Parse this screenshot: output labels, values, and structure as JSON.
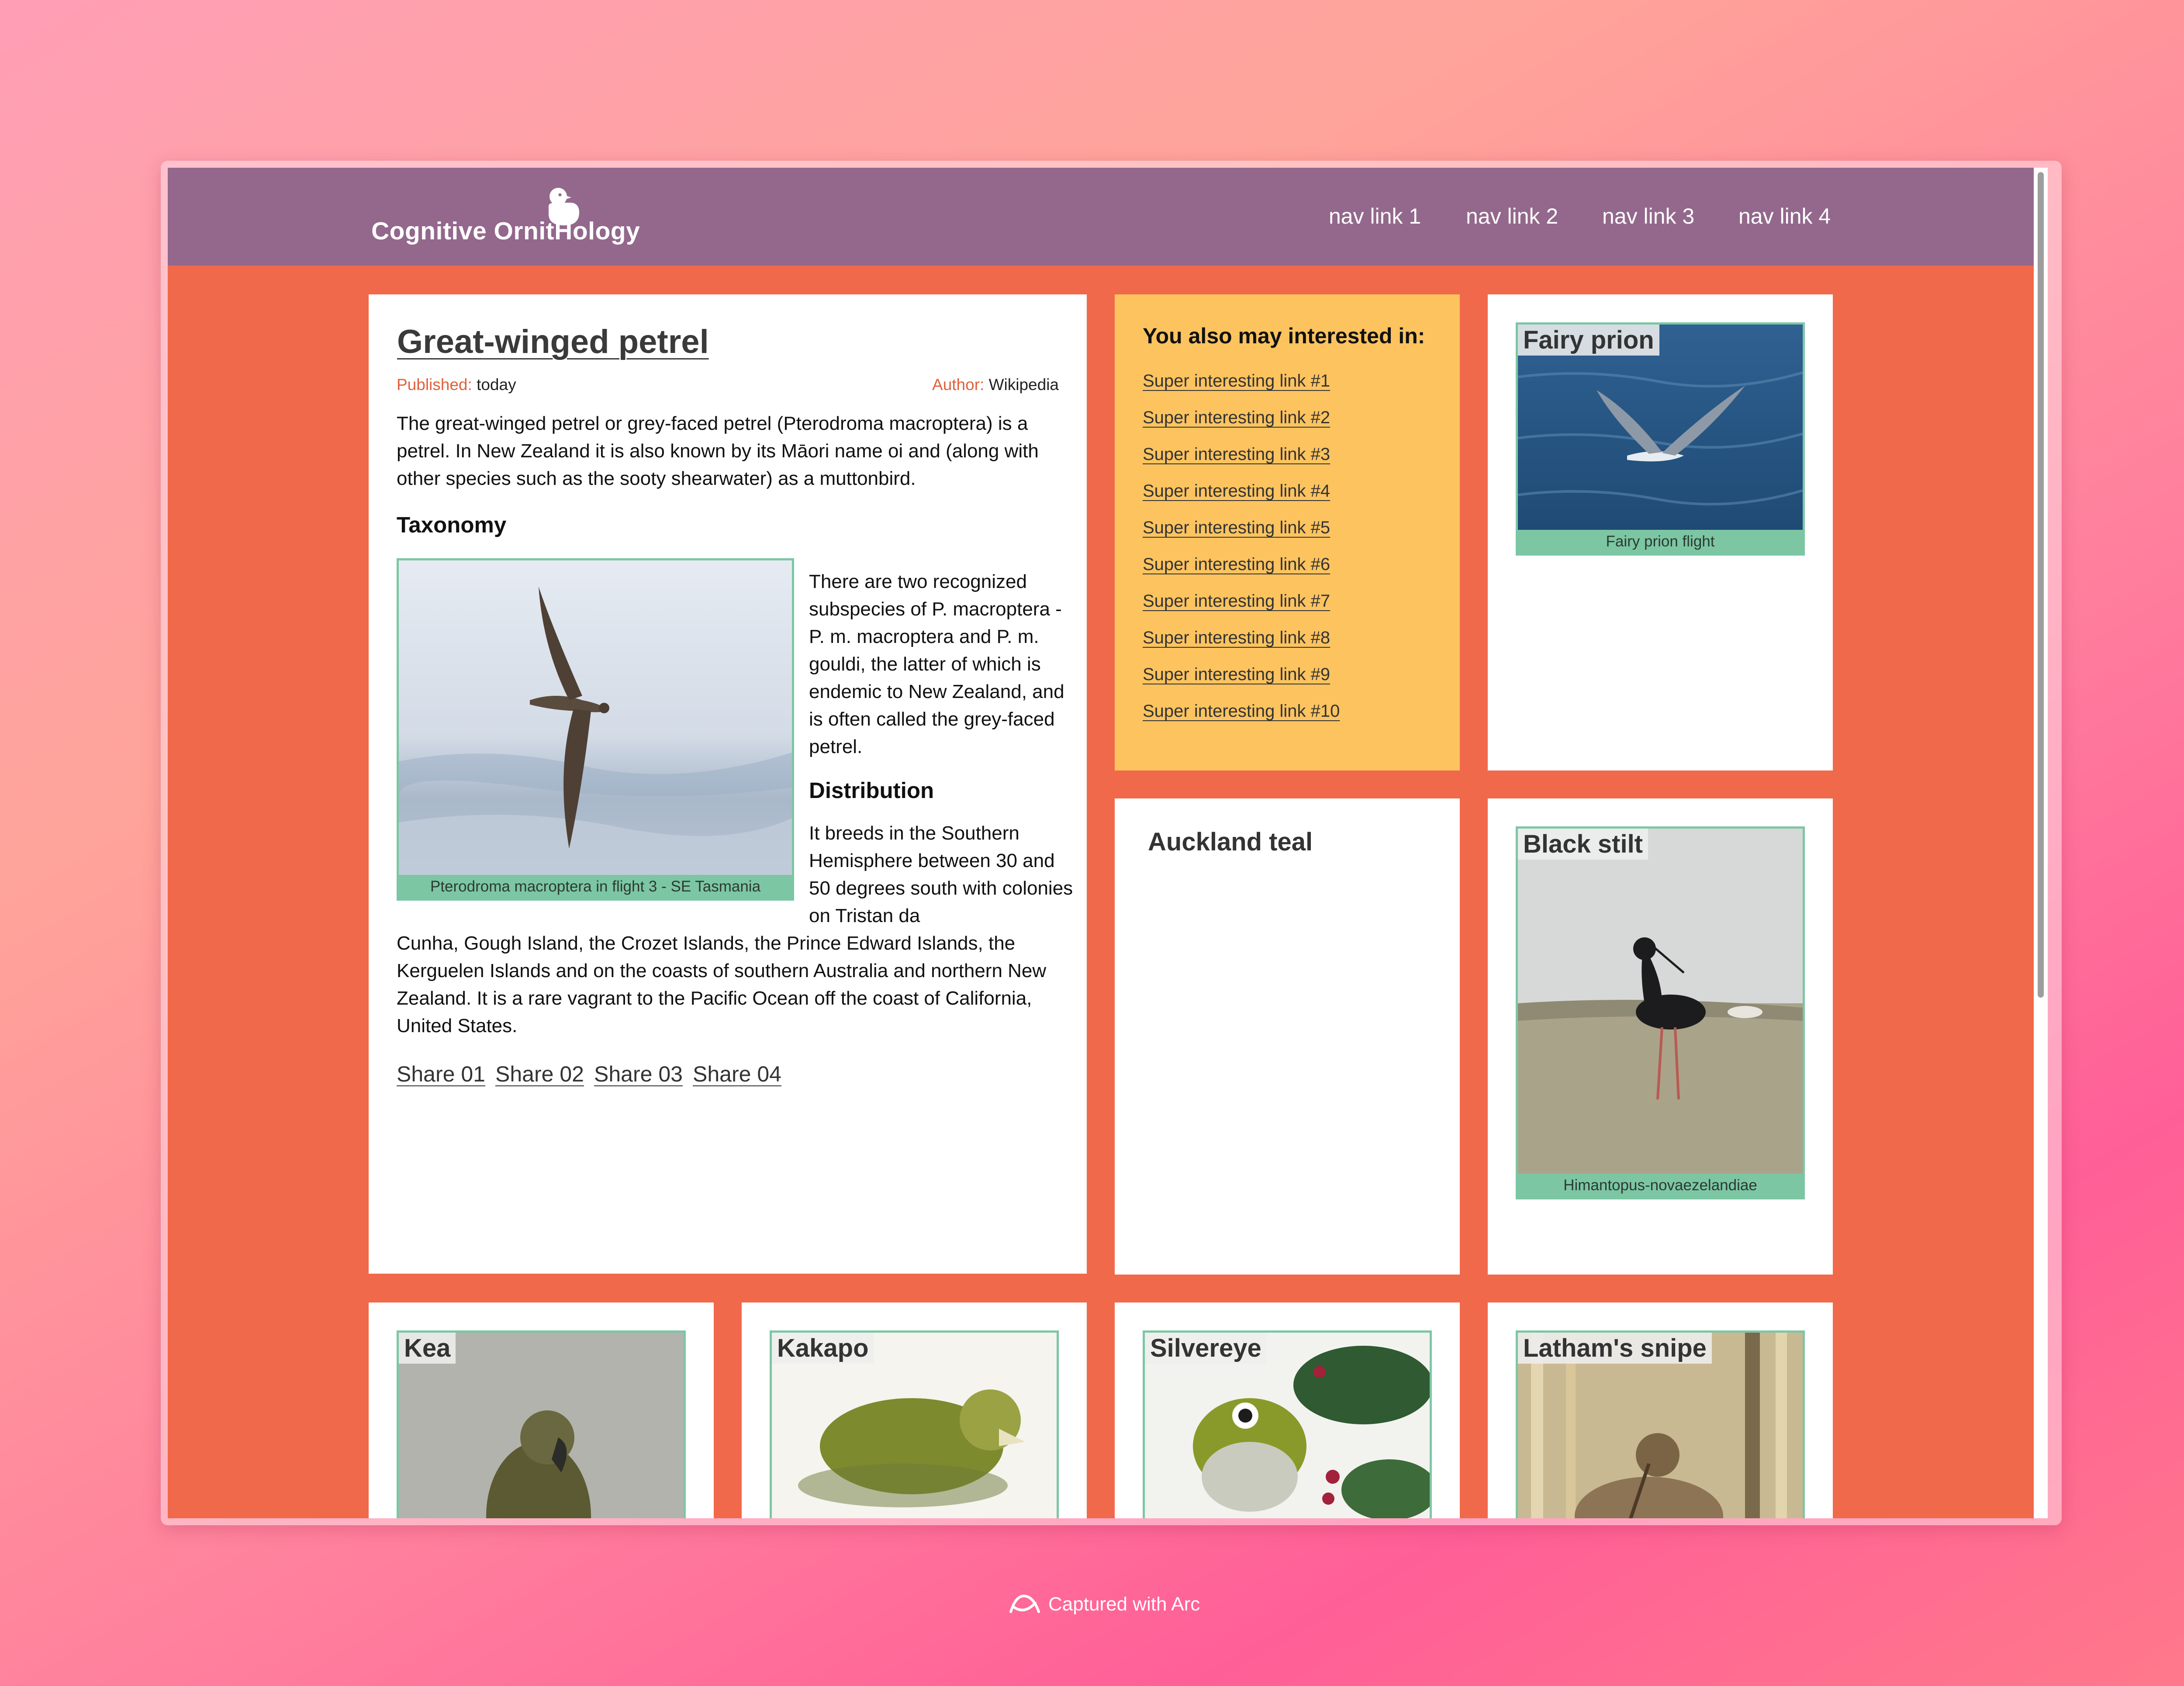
{
  "header": {
    "logo_text": "Cognitive OrnitHology",
    "nav": [
      "nav link 1",
      "nav link 2",
      "nav link 3",
      "nav link 4"
    ]
  },
  "article": {
    "title": "Great-winged petrel",
    "published_label": "Published:",
    "published_value": "today",
    "author_label": "Author:",
    "author_value": "Wikipedia",
    "intro": "The great-winged petrel or grey-faced petrel (Pterodroma macroptera) is a petrel. In New Zealand it is also known by its Māori name oi and (along with other species such as the sooty shearwater) as a muttonbird.",
    "taxonomy_heading": "Taxonomy",
    "taxonomy_text": "There are two recognized subspecies of P. macroptera - P. m. macroptera and P. m. gouldi, the latter of which is endemic to New Zealand, and is often called the grey-faced petrel.",
    "figure_caption": "Pterodroma macroptera in flight 3 - SE Tasmania",
    "distribution_heading": "Distribution",
    "distribution_text_side": "It breeds in the Southern Hemisphere between 30 and 50 degrees south with colonies on Tristan da",
    "distribution_text_full": "Cunha, Gough Island, the Crozet Islands, the Prince Edward Islands, the Kerguelen Islands and on the coasts of southern Australia and northern New Zealand. It is a rare vagrant to the Pacific Ocean off the coast of California, United States.",
    "shares": [
      "Share 01",
      "Share 02",
      "Share 03",
      "Share 04"
    ]
  },
  "interest": {
    "title": "You also may interested in:",
    "links": [
      "Super interesting link #1",
      "Super interesting link #2",
      "Super interesting link #3",
      "Super interesting link #4",
      "Super interesting link #5",
      "Super interesting link #6",
      "Super interesting link #7",
      "Super interesting link #8",
      "Super interesting link #9",
      "Super interesting link #10"
    ]
  },
  "cards": {
    "fairy_prion": {
      "title": "Fairy prion",
      "caption": "Fairy prion flight"
    },
    "auckland_teal": {
      "title": "Auckland teal"
    },
    "black_stilt": {
      "title": "Black stilt",
      "caption": "Himantopus-novaezelandiae"
    },
    "kea": {
      "title": "Kea"
    },
    "kakapo": {
      "title": "Kakapo"
    },
    "silvereye": {
      "title": "Silvereye"
    },
    "lathams_snipe": {
      "title": "Latham's snipe"
    }
  },
  "footer": {
    "text": "Captured with Arc"
  },
  "colors": {
    "page_bg": "#f0694b",
    "navbar": "#93688c",
    "accent_green": "#7cc6a4",
    "card_yellow": "#fcc35f",
    "meta_label": "#e0603c"
  }
}
